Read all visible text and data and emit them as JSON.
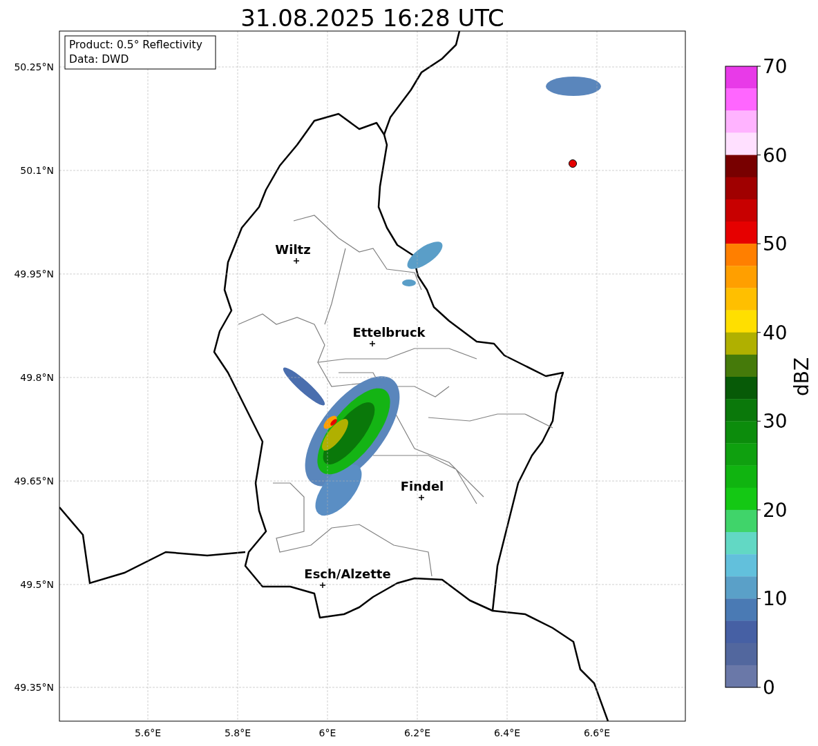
{
  "title": "31.08.2025 16:28 UTC",
  "info_box": [
    "Product: 0.5° Reflectivity",
    "Data: DWD"
  ],
  "map": {
    "yticks": [
      "50.25°N",
      "50.1°N",
      "49.95°N",
      "49.8°N",
      "49.65°N",
      "49.5°N",
      "49.35°N"
    ],
    "xticks": [
      "5.6°E",
      "5.8°E",
      "6°E",
      "6.2°E",
      "6.4°E",
      "6.6°E"
    ],
    "cities": [
      {
        "name": "Wiltz"
      },
      {
        "name": "Ettelbruck"
      },
      {
        "name": "Findel"
      },
      {
        "name": "Esch/Alzette"
      }
    ]
  },
  "colorbar": {
    "label": "dBZ",
    "ticks": [
      "70",
      "60",
      "50",
      "40",
      "30",
      "20",
      "10",
      "0"
    ],
    "segments": [
      {
        "color": "#e83ae8"
      },
      {
        "color": "#ff66ff"
      },
      {
        "color": "#ffb3ff"
      },
      {
        "color": "#ffe0ff"
      },
      {
        "color": "#780000"
      },
      {
        "color": "#a00000"
      },
      {
        "color": "#c80000"
      },
      {
        "color": "#e60000"
      },
      {
        "color": "#ff7f00"
      },
      {
        "color": "#ff9f00"
      },
      {
        "color": "#ffbf00"
      },
      {
        "color": "#ffdf00"
      },
      {
        "color": "#b0b000"
      },
      {
        "color": "#457a0a"
      },
      {
        "color": "#075a07"
      },
      {
        "color": "#0a780a"
      },
      {
        "color": "#0c8c0c"
      },
      {
        "color": "#0fa00f"
      },
      {
        "color": "#10b410"
      },
      {
        "color": "#14c814"
      },
      {
        "color": "#40d46a"
      },
      {
        "color": "#62d8c4"
      },
      {
        "color": "#62c0dc"
      },
      {
        "color": "#5aa0c8"
      },
      {
        "color": "#4a7ab4"
      },
      {
        "color": "#4660a4"
      },
      {
        "color": "#52679e"
      },
      {
        "color": "#6a78a8"
      }
    ]
  }
}
